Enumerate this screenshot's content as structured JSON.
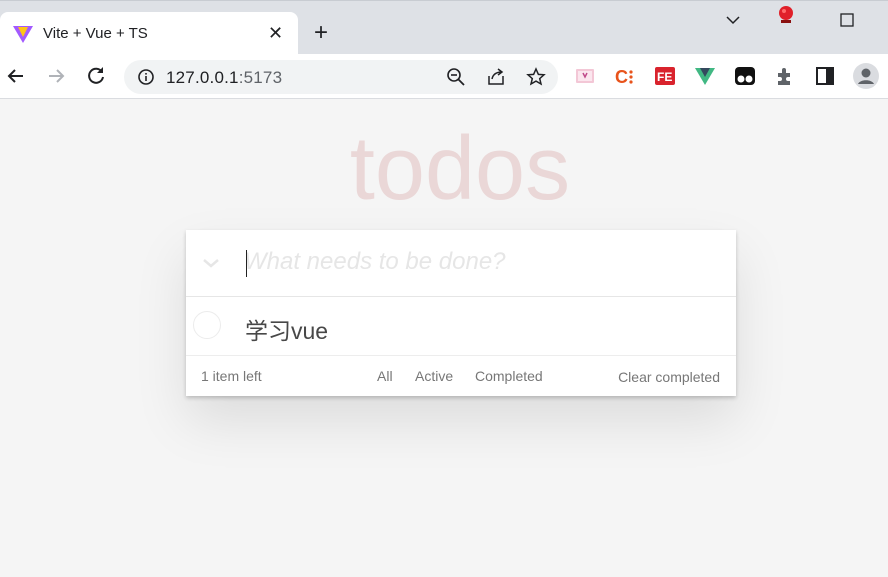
{
  "browser": {
    "tab_title": "Vite + Vue + TS",
    "url_host": "127.0.0.1",
    "url_port": ":5173",
    "colors": {
      "accent_vite_purple": "#a259ff",
      "accent_vite_yellow": "#ffc517",
      "vue_green": "#41b883"
    }
  },
  "todo": {
    "title": "todos",
    "placeholder": "What needs to be done?",
    "items": [
      {
        "label": "学习vue",
        "completed": false
      }
    ],
    "footer": {
      "count": "1 item left",
      "filter_all": "All",
      "filter_active": "Active",
      "filter_completed": "Completed",
      "clear_completed": "Clear completed"
    }
  }
}
